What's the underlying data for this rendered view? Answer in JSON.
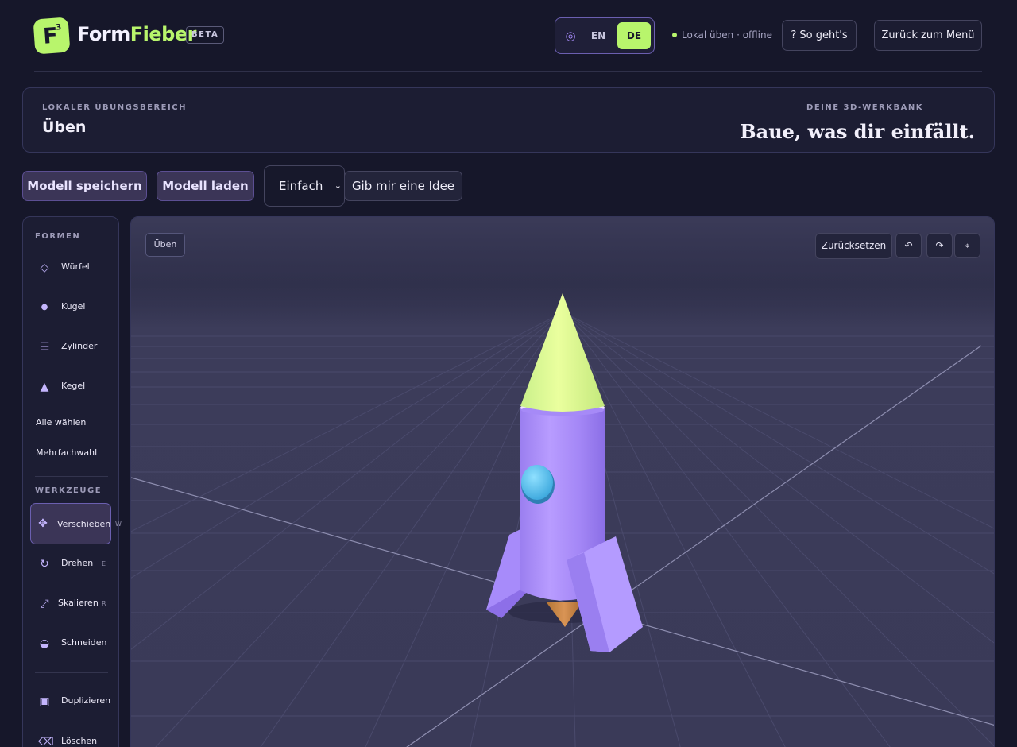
{
  "header": {
    "logo_letter": "F",
    "logo_sup": "3",
    "brand_part1": "Form",
    "brand_part2": "Fieber",
    "beta": "BETA",
    "lang_en": "EN",
    "lang_de": "DE",
    "status": "Lokal üben · offline",
    "help_button": "? So geht's",
    "menu_button": "Zurück zum Menü"
  },
  "info": {
    "left_label": "LOKALER ÜBUNGSBEREICH",
    "left_title": "Üben",
    "right_label": "DEINE 3D-WERKBANK",
    "right_title": "Baue, was dir einfällt."
  },
  "toolbar": {
    "save_model": "Modell speichern",
    "load_model": "Modell laden",
    "difficulty": "Einfach",
    "idea_button": "Gib mir eine Idee"
  },
  "sidebar": {
    "shapes_heading": "FORMEN",
    "shapes": [
      "Würfel",
      "Kugel",
      "Zylinder",
      "Kegel"
    ],
    "select_all": "Alle wählen",
    "multi_select": "Mehrfachwahl",
    "tools_heading": "WERKZEUGE",
    "tools": [
      {
        "label": "Verschieben",
        "hotkey": "W"
      },
      {
        "label": "Drehen",
        "hotkey": "E"
      },
      {
        "label": "Skalieren",
        "hotkey": "R"
      },
      {
        "label": "Schneiden",
        "hotkey": ""
      }
    ],
    "duplicate": "Duplizieren",
    "delete": "Löschen"
  },
  "viewport": {
    "mode_tag": "Üben",
    "reset_button": "Zurücksetzen",
    "undo_icon": "undo-icon",
    "redo_icon": "redo-icon",
    "focus_icon": "crosshair-icon"
  },
  "colors": {
    "accent_green": "#b8f56c",
    "accent_purple": "#a78bfa",
    "background": "#16172a"
  }
}
